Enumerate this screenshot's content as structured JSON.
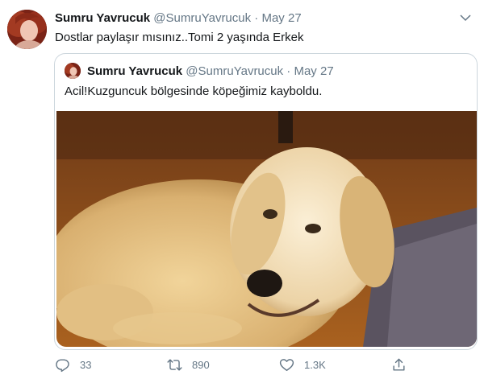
{
  "tweet": {
    "author_name": "Sumru Yavrucuk",
    "author_handle": "@SumruYavrucuk",
    "separator": " · ",
    "date": "May 27",
    "text": "Dostlar paylaşır mısınız..Tomi 2 yaşında Erkek"
  },
  "quoted": {
    "author_name": "Sumru Yavrucuk",
    "author_handle": "@SumruYavrucuk",
    "separator": " · ",
    "date": "May 27",
    "text": "Acil!Kuzguncuk bölgesinde köpeğimiz kayboldu."
  },
  "actions": {
    "replies": "33",
    "retweets": "890",
    "likes": "1.3K"
  },
  "icons": [
    "avatar-photo",
    "chevron-down-icon",
    "reply-icon",
    "retweet-icon",
    "like-icon",
    "share-icon"
  ],
  "colors": {
    "text": "#14171a",
    "secondary": "#657786",
    "border": "#ccd6dd"
  }
}
